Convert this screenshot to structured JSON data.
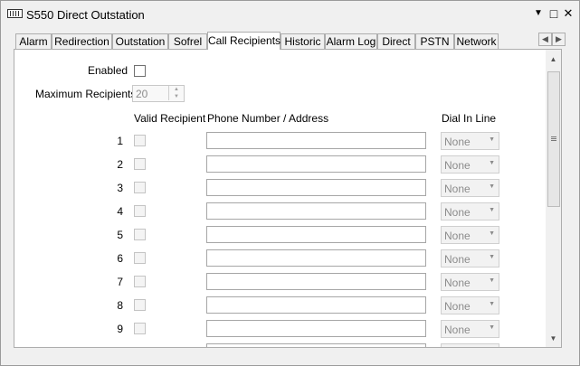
{
  "window": {
    "title": "S550 Direct Outstation",
    "menu_glyph": "▼",
    "maximize_glyph": "□",
    "close_glyph": "✕"
  },
  "tabs": [
    {
      "label": "Alarm"
    },
    {
      "label": "Redirection"
    },
    {
      "label": "Outstation"
    },
    {
      "label": "Sofrel"
    },
    {
      "label": "Call Recipients",
      "active": true
    },
    {
      "label": "Historic"
    },
    {
      "label": "Alarm Log"
    },
    {
      "label": "Direct"
    },
    {
      "label": "PSTN"
    },
    {
      "label": "Network"
    }
  ],
  "tab_scroll": {
    "left": "◀",
    "right": "▶"
  },
  "form": {
    "enabled_label": "Enabled",
    "max_recipients_label": "Maximum Recipients",
    "max_recipients_value": "20",
    "col_valid": "Valid Recipient",
    "col_phone": "Phone Number / Address",
    "col_dial": "Dial In Line"
  },
  "recipients": [
    {
      "num": "1",
      "dial": "None"
    },
    {
      "num": "2",
      "dial": "None"
    },
    {
      "num": "3",
      "dial": "None"
    },
    {
      "num": "4",
      "dial": "None"
    },
    {
      "num": "5",
      "dial": "None"
    },
    {
      "num": "6",
      "dial": "None"
    },
    {
      "num": "7",
      "dial": "None"
    },
    {
      "num": "8",
      "dial": "None"
    },
    {
      "num": "9",
      "dial": "None"
    },
    {
      "num": "",
      "dial": ""
    }
  ]
}
